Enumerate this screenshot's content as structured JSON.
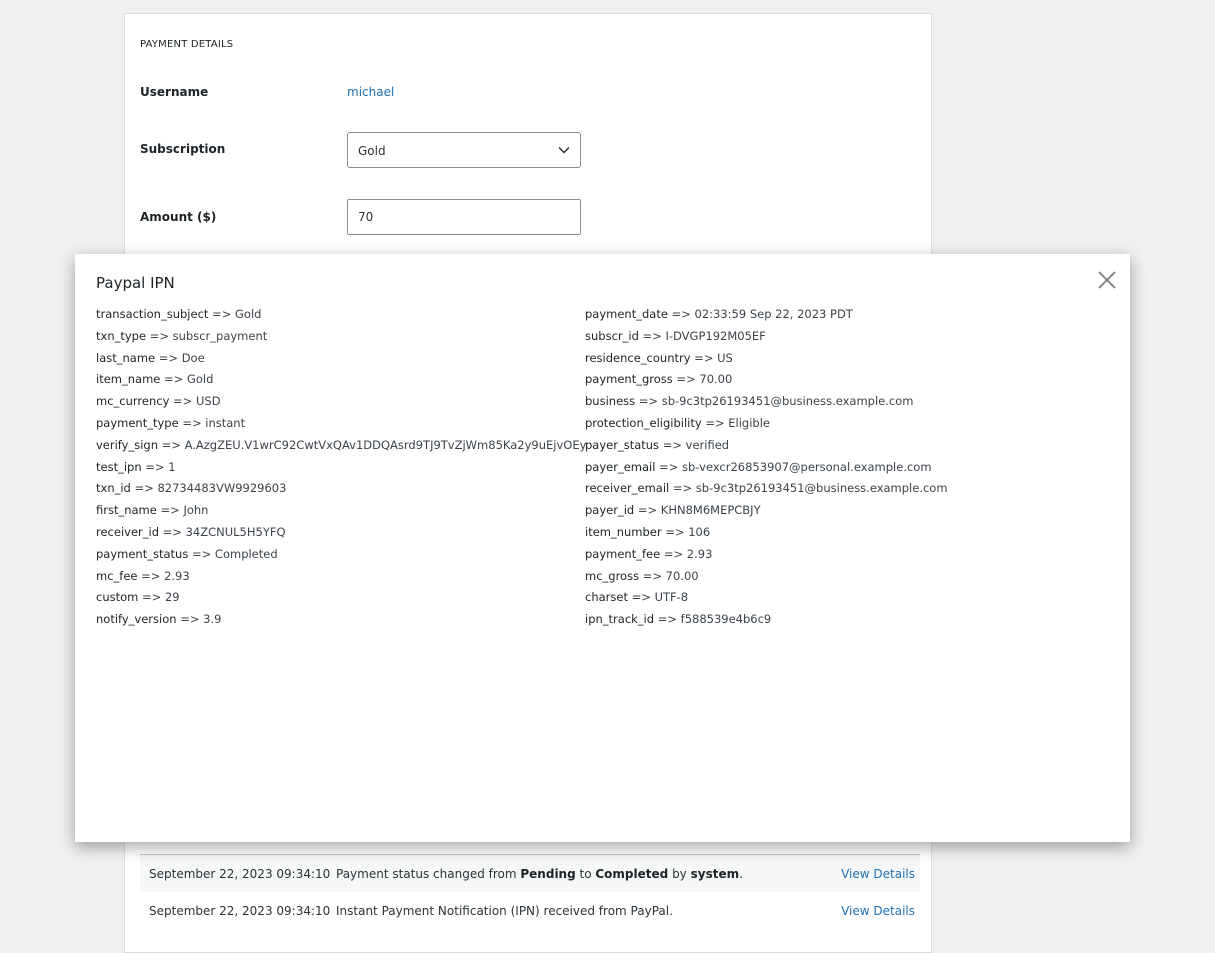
{
  "panel": {
    "section_title": "PAYMENT DETAILS",
    "username_label": "Username",
    "username_value": "michael",
    "subscription_label": "Subscription",
    "subscription_value": "Gold",
    "amount_label": "Amount ($)",
    "amount_value": "70"
  },
  "logs": [
    {
      "date": "September 22, 2023 09:34:10",
      "msg_pre": "Payment status changed from ",
      "msg_from": "Pending",
      "msg_mid": " to ",
      "msg_to": "Completed",
      "msg_by": " by ",
      "msg_actor": "system",
      "msg_end": ".",
      "link": "View Details"
    },
    {
      "date": "September 22, 2023 09:34:10",
      "msg": "Instant Payment Notification (IPN) received from PayPal.",
      "link": "View Details"
    }
  ],
  "modal": {
    "title": "Paypal IPN",
    "separator": " => ",
    "left": [
      {
        "key": "transaction_subject",
        "value": "Gold"
      },
      {
        "key": "txn_type",
        "value": "subscr_payment"
      },
      {
        "key": "last_name",
        "value": "Doe"
      },
      {
        "key": "item_name",
        "value": "Gold"
      },
      {
        "key": "mc_currency",
        "value": "USD"
      },
      {
        "key": "payment_type",
        "value": "instant"
      },
      {
        "key": "verify_sign",
        "value": "A.AzgZEU.V1wrC92CwtVxQAv1DDQAsrd9TJ9TvZjWm85Ka2y9uEjvOEy"
      },
      {
        "key": "test_ipn",
        "value": "1"
      },
      {
        "key": "txn_id",
        "value": "82734483VW9929603"
      },
      {
        "key": "first_name",
        "value": "John"
      },
      {
        "key": "receiver_id",
        "value": "34ZCNUL5H5YFQ"
      },
      {
        "key": "payment_status",
        "value": "Completed"
      },
      {
        "key": "mc_fee",
        "value": "2.93"
      },
      {
        "key": "custom",
        "value": "29"
      },
      {
        "key": "notify_version",
        "value": "3.9"
      }
    ],
    "right": [
      {
        "key": "payment_date",
        "value": "02:33:59 Sep 22, 2023 PDT"
      },
      {
        "key": "subscr_id",
        "value": "I-DVGP192M05EF"
      },
      {
        "key": "residence_country",
        "value": "US"
      },
      {
        "key": "payment_gross",
        "value": "70.00"
      },
      {
        "key": "business",
        "value": "sb-9c3tp26193451@business.example.com"
      },
      {
        "key": "protection_eligibility",
        "value": "Eligible"
      },
      {
        "key": "payer_status",
        "value": "verified"
      },
      {
        "key": "payer_email",
        "value": "sb-vexcr26853907@personal.example.com"
      },
      {
        "key": "receiver_email",
        "value": "sb-9c3tp26193451@business.example.com"
      },
      {
        "key": "payer_id",
        "value": "KHN8M6MEPCBJY"
      },
      {
        "key": "item_number",
        "value": "106"
      },
      {
        "key": "payment_fee",
        "value": "2.93"
      },
      {
        "key": "mc_gross",
        "value": "70.00"
      },
      {
        "key": "charset",
        "value": "UTF-8"
      },
      {
        "key": "ipn_track_id",
        "value": "f588539e4b6c9"
      }
    ]
  },
  "colors": {
    "link": "#2271b1",
    "background": "#f0f0f1"
  },
  "icons": {
    "close": "close-icon",
    "select": "chevron-down-icon"
  }
}
